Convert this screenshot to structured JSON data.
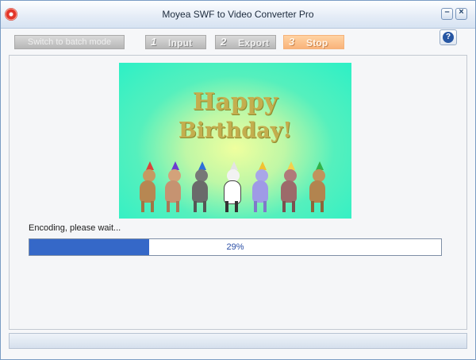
{
  "window": {
    "title": "Moyea SWF to Video Converter Pro",
    "minimize_icon": "minimize-icon",
    "close_icon": "close-icon",
    "minimize_glyph": "–",
    "close_glyph": "×"
  },
  "toolbar": {
    "batch_mode_label": "Switch to batch mode",
    "help_glyph": "?",
    "steps": [
      {
        "number": "1",
        "label": "Input"
      },
      {
        "number": "2",
        "label": "Export"
      },
      {
        "number": "3",
        "label": "Stop"
      }
    ]
  },
  "preview": {
    "line1": "Happy",
    "line2": "Birthday!"
  },
  "encoding": {
    "status_text": "Encoding, please wait...",
    "progress_text": "29%",
    "progress_fraction": 0.29
  },
  "colors": {
    "accent": "#3568c8",
    "stop_button": "#f9b37a"
  }
}
